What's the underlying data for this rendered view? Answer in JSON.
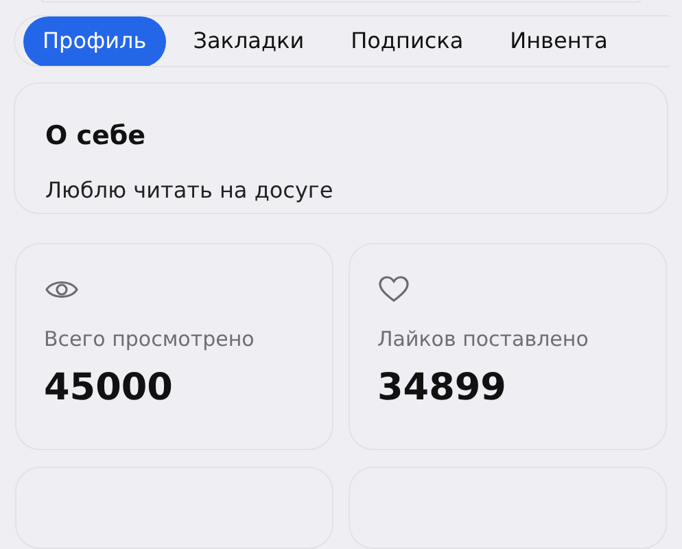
{
  "tabs": [
    {
      "label": "Профиль",
      "selected": true
    },
    {
      "label": "Закладки",
      "selected": false
    },
    {
      "label": "Подписка",
      "selected": false
    },
    {
      "label": "Инвента",
      "selected": false
    }
  ],
  "about": {
    "title": "О себе",
    "text": "Люблю читать на досуге"
  },
  "stats": [
    {
      "kind": "views",
      "label": "Всего просмотрено",
      "value": "45000"
    },
    {
      "kind": "likes",
      "label": "Лайков поставлено",
      "value": "34899"
    }
  ]
}
